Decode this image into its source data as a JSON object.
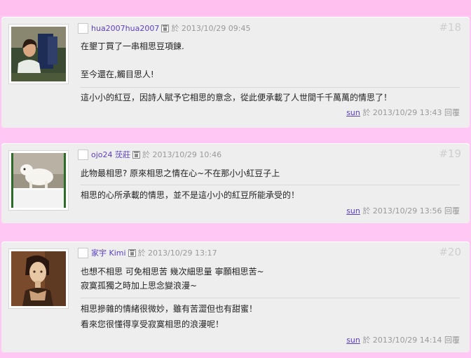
{
  "posts": [
    {
      "username": "hua2007hua2007",
      "sep": "於",
      "datetime": "2013/10/29 09:45",
      "number": "#18",
      "lines": [
        "在墾丁買了一串相思豆項鍊.",
        "",
        "至今還在,觸目思人!"
      ],
      "reply_lines": [
        "這小小的紅豆，因詩人賦予它相思的意念，從此便承載了人世間千千萬萬的情思了！"
      ],
      "reply_user": "sun",
      "reply_sep": "於",
      "reply_datetime": "2013/10/29 13:43",
      "reply_label": "回覆",
      "avatar_icon": "woman-photo"
    },
    {
      "username": "ojo24 莐莊",
      "sep": "於",
      "datetime": "2013/10/29 10:46",
      "number": "#19",
      "lines": [
        "此物最相思? 原來相思之情在心~不在那小小紅豆子上"
      ],
      "reply_lines": [
        "相思的心所承載的情思，並不是這小小的紅豆所能承受的！"
      ],
      "reply_user": "sun",
      "reply_sep": "於",
      "reply_datetime": "2013/10/29 13:56",
      "reply_label": "回覆",
      "avatar_icon": "white-dog-photo"
    },
    {
      "username": "家宇 Kimi",
      "sep": "於",
      "datetime": "2013/10/29 13:17",
      "number": "#20",
      "lines": [
        "也想不相思 可免相思苦 幾次細思量 寧願相思苦~",
        "寂寞孤獨之時加上思念變浪漫~"
      ],
      "reply_lines": [
        "相思摻雜的情緒很微妙，雖有苦澀但也有甜蜜！",
        "看來您很懂得享受寂寞相思的浪漫呢！"
      ],
      "reply_user": "sun",
      "reply_sep": "於",
      "reply_datetime": "2013/10/29 14:14",
      "reply_label": "回覆",
      "avatar_icon": "portrait-painting"
    }
  ]
}
